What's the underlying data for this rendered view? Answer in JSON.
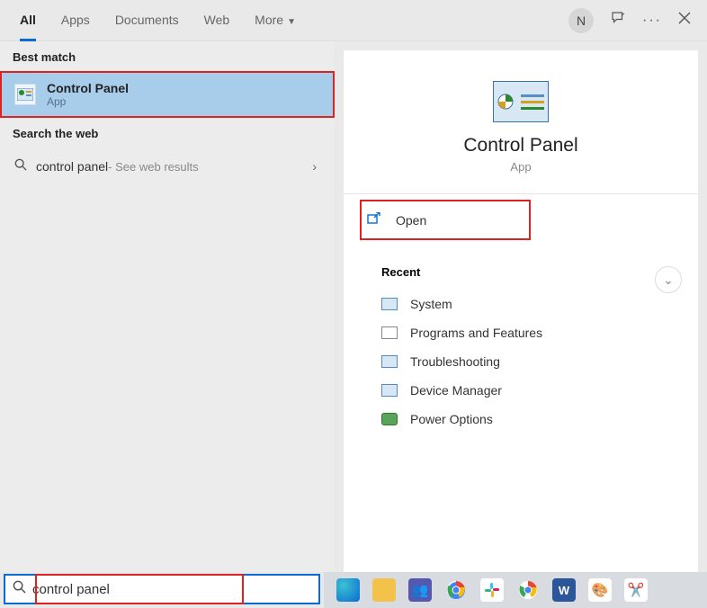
{
  "topbar": {
    "tabs": [
      "All",
      "Apps",
      "Documents",
      "Web",
      "More"
    ],
    "avatar_initial": "N"
  },
  "left": {
    "best_match_label": "Best match",
    "result": {
      "title": "Control Panel",
      "subtitle": "App"
    },
    "search_web_label": "Search the web",
    "web_query": "control panel",
    "web_hint": " - See web results"
  },
  "preview": {
    "title": "Control Panel",
    "subtitle": "App",
    "open_label": "Open",
    "recent_label": "Recent",
    "recent": [
      "System",
      "Programs and Features",
      "Troubleshooting",
      "Device Manager",
      "Power Options"
    ]
  },
  "search": {
    "value": "control panel"
  },
  "taskbar": {
    "items": [
      "edge",
      "explorer",
      "teams",
      "chrome",
      "slack",
      "chrome-canary",
      "word",
      "paint",
      "snip"
    ]
  }
}
